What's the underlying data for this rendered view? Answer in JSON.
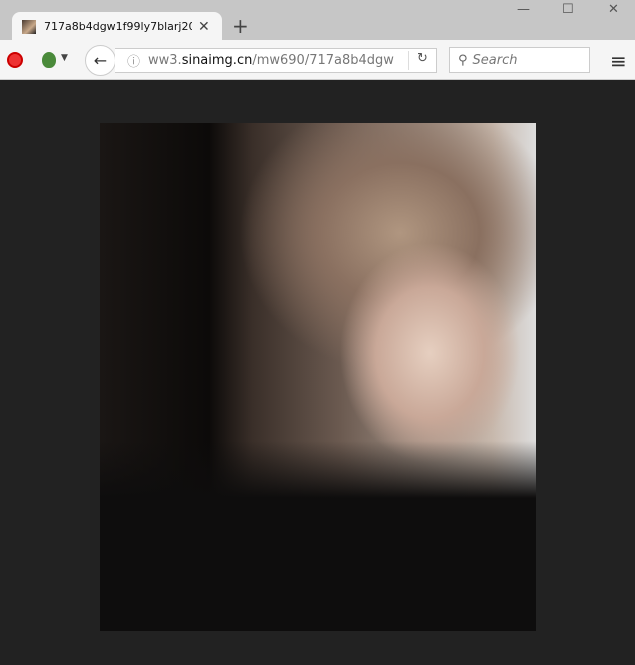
{
  "tab": {
    "title": "717a8b4dgw1f99ly7blarj20...",
    "close_icon": "close-icon"
  },
  "new_tab_label": "+",
  "window_controls": {
    "minimize": "—",
    "maximize": "☐",
    "close": "✕"
  },
  "toolbar": {
    "url_prefix": "ww3.",
    "url_host": "sinaimg.cn",
    "url_path": "/mw690/717a8b4dgw",
    "search_placeholder": "Search",
    "back_glyph": "🡐",
    "reload_glyph": "↻",
    "menu_glyph": "≡",
    "info_glyph": "ⓘ"
  },
  "image": {
    "description_icon": "portrait-photo"
  }
}
